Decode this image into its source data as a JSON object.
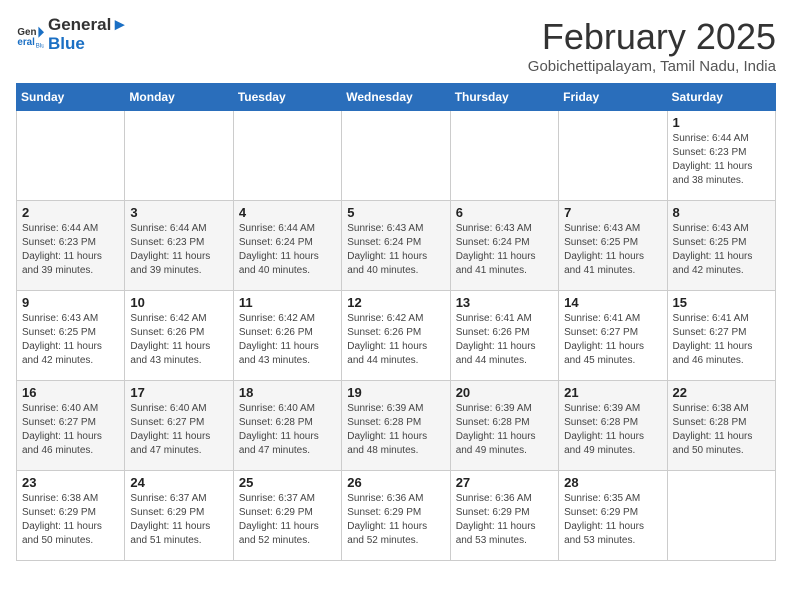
{
  "header": {
    "logo_general": "General",
    "logo_blue": "Blue",
    "title": "February 2025",
    "subtitle": "Gobichettipalayam, Tamil Nadu, India"
  },
  "days_of_week": [
    "Sunday",
    "Monday",
    "Tuesday",
    "Wednesday",
    "Thursday",
    "Friday",
    "Saturday"
  ],
  "weeks": [
    [
      {
        "day": "",
        "info": ""
      },
      {
        "day": "",
        "info": ""
      },
      {
        "day": "",
        "info": ""
      },
      {
        "day": "",
        "info": ""
      },
      {
        "day": "",
        "info": ""
      },
      {
        "day": "",
        "info": ""
      },
      {
        "day": "1",
        "info": "Sunrise: 6:44 AM\nSunset: 6:23 PM\nDaylight: 11 hours\nand 38 minutes."
      }
    ],
    [
      {
        "day": "2",
        "info": "Sunrise: 6:44 AM\nSunset: 6:23 PM\nDaylight: 11 hours\nand 39 minutes."
      },
      {
        "day": "3",
        "info": "Sunrise: 6:44 AM\nSunset: 6:23 PM\nDaylight: 11 hours\nand 39 minutes."
      },
      {
        "day": "4",
        "info": "Sunrise: 6:44 AM\nSunset: 6:24 PM\nDaylight: 11 hours\nand 40 minutes."
      },
      {
        "day": "5",
        "info": "Sunrise: 6:43 AM\nSunset: 6:24 PM\nDaylight: 11 hours\nand 40 minutes."
      },
      {
        "day": "6",
        "info": "Sunrise: 6:43 AM\nSunset: 6:24 PM\nDaylight: 11 hours\nand 41 minutes."
      },
      {
        "day": "7",
        "info": "Sunrise: 6:43 AM\nSunset: 6:25 PM\nDaylight: 11 hours\nand 41 minutes."
      },
      {
        "day": "8",
        "info": "Sunrise: 6:43 AM\nSunset: 6:25 PM\nDaylight: 11 hours\nand 42 minutes."
      }
    ],
    [
      {
        "day": "9",
        "info": "Sunrise: 6:43 AM\nSunset: 6:25 PM\nDaylight: 11 hours\nand 42 minutes."
      },
      {
        "day": "10",
        "info": "Sunrise: 6:42 AM\nSunset: 6:26 PM\nDaylight: 11 hours\nand 43 minutes."
      },
      {
        "day": "11",
        "info": "Sunrise: 6:42 AM\nSunset: 6:26 PM\nDaylight: 11 hours\nand 43 minutes."
      },
      {
        "day": "12",
        "info": "Sunrise: 6:42 AM\nSunset: 6:26 PM\nDaylight: 11 hours\nand 44 minutes."
      },
      {
        "day": "13",
        "info": "Sunrise: 6:41 AM\nSunset: 6:26 PM\nDaylight: 11 hours\nand 44 minutes."
      },
      {
        "day": "14",
        "info": "Sunrise: 6:41 AM\nSunset: 6:27 PM\nDaylight: 11 hours\nand 45 minutes."
      },
      {
        "day": "15",
        "info": "Sunrise: 6:41 AM\nSunset: 6:27 PM\nDaylight: 11 hours\nand 46 minutes."
      }
    ],
    [
      {
        "day": "16",
        "info": "Sunrise: 6:40 AM\nSunset: 6:27 PM\nDaylight: 11 hours\nand 46 minutes."
      },
      {
        "day": "17",
        "info": "Sunrise: 6:40 AM\nSunset: 6:27 PM\nDaylight: 11 hours\nand 47 minutes."
      },
      {
        "day": "18",
        "info": "Sunrise: 6:40 AM\nSunset: 6:28 PM\nDaylight: 11 hours\nand 47 minutes."
      },
      {
        "day": "19",
        "info": "Sunrise: 6:39 AM\nSunset: 6:28 PM\nDaylight: 11 hours\nand 48 minutes."
      },
      {
        "day": "20",
        "info": "Sunrise: 6:39 AM\nSunset: 6:28 PM\nDaylight: 11 hours\nand 49 minutes."
      },
      {
        "day": "21",
        "info": "Sunrise: 6:39 AM\nSunset: 6:28 PM\nDaylight: 11 hours\nand 49 minutes."
      },
      {
        "day": "22",
        "info": "Sunrise: 6:38 AM\nSunset: 6:28 PM\nDaylight: 11 hours\nand 50 minutes."
      }
    ],
    [
      {
        "day": "23",
        "info": "Sunrise: 6:38 AM\nSunset: 6:29 PM\nDaylight: 11 hours\nand 50 minutes."
      },
      {
        "day": "24",
        "info": "Sunrise: 6:37 AM\nSunset: 6:29 PM\nDaylight: 11 hours\nand 51 minutes."
      },
      {
        "day": "25",
        "info": "Sunrise: 6:37 AM\nSunset: 6:29 PM\nDaylight: 11 hours\nand 52 minutes."
      },
      {
        "day": "26",
        "info": "Sunrise: 6:36 AM\nSunset: 6:29 PM\nDaylight: 11 hours\nand 52 minutes."
      },
      {
        "day": "27",
        "info": "Sunrise: 6:36 AM\nSunset: 6:29 PM\nDaylight: 11 hours\nand 53 minutes."
      },
      {
        "day": "28",
        "info": "Sunrise: 6:35 AM\nSunset: 6:29 PM\nDaylight: 11 hours\nand 53 minutes."
      },
      {
        "day": "",
        "info": ""
      }
    ]
  ]
}
